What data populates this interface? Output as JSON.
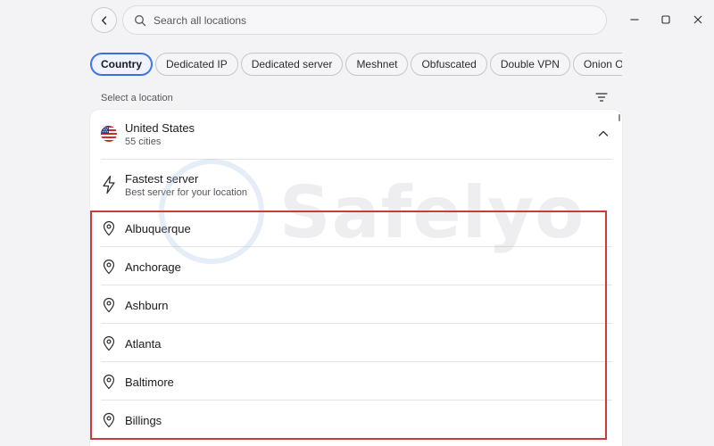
{
  "header": {
    "search_placeholder": "Search all locations"
  },
  "tabs": [
    {
      "label": "Country",
      "active": true
    },
    {
      "label": "Dedicated IP",
      "active": false
    },
    {
      "label": "Dedicated server",
      "active": false
    },
    {
      "label": "Meshnet",
      "active": false
    },
    {
      "label": "Obfuscated",
      "active": false
    },
    {
      "label": "Double VPN",
      "active": false
    },
    {
      "label": "Onion Over VPN",
      "active": false
    }
  ],
  "section_label": "Select a location",
  "country": {
    "name": "United States",
    "sub": "55 cities",
    "flag": "us-flag"
  },
  "fastest": {
    "title": "Fastest server",
    "sub": "Best server for your location"
  },
  "cities": [
    "Albuquerque",
    "Anchorage",
    "Ashburn",
    "Atlanta",
    "Baltimore",
    "Billings"
  ],
  "watermark": "Safelyo",
  "colors": {
    "accent": "#3b6fe0",
    "highlight": "#cc3a3a",
    "background": "#f3f3f5",
    "panel": "#ffffff"
  }
}
